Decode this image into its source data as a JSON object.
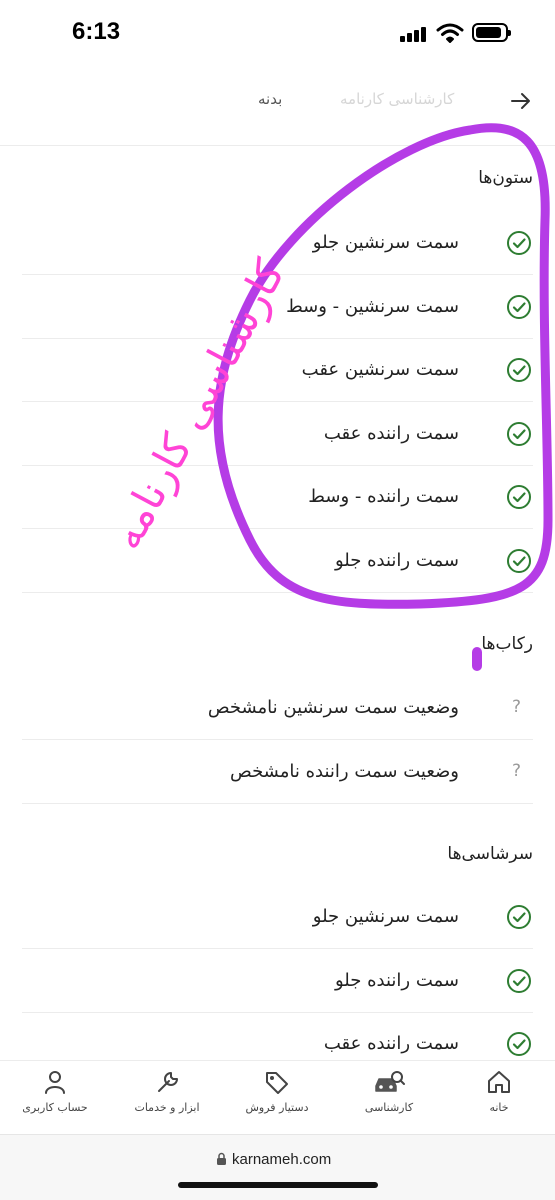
{
  "status_bar": {
    "time": "6:13",
    "battery_level": 0.9
  },
  "header": {
    "title": "کارشناسی کارنامه",
    "crumb": "بدنه"
  },
  "sections": {
    "pillars": {
      "title": "ستون‌ها",
      "items": [
        {
          "label": "سمت سرنشین جلو",
          "status": "ok"
        },
        {
          "label": "سمت سرنشین - وسط",
          "status": "ok"
        },
        {
          "label": "سمت سرنشین عقب",
          "status": "ok"
        },
        {
          "label": "سمت راننده عقب",
          "status": "ok"
        },
        {
          "label": "سمت راننده - وسط",
          "status": "ok"
        },
        {
          "label": "سمت راننده جلو",
          "status": "ok"
        }
      ]
    },
    "steps": {
      "title": "رکاب‌ها",
      "items": [
        {
          "label": "وضعیت سمت سرنشین نامشخص",
          "status": "unknown",
          "icon": "?"
        },
        {
          "label": "وضعیت سمت راننده نامشخص",
          "status": "unknown",
          "icon": "?"
        }
      ]
    },
    "roof_rails": {
      "title": "سرشاسی‌ها",
      "items": [
        {
          "label": "سمت سرنشین جلو",
          "status": "ok"
        },
        {
          "label": "سمت راننده جلو",
          "status": "ok"
        },
        {
          "label": "سمت راننده عقب",
          "status": "ok"
        }
      ]
    }
  },
  "annotation": {
    "text": "کارشناسی کارنامه",
    "color": "#ff44d6",
    "marker_color": "#b53ce6"
  },
  "tabbar": {
    "items": [
      {
        "label": "خانه",
        "icon": "home-icon"
      },
      {
        "label": "کارشناسی",
        "icon": "car-inspection-icon"
      },
      {
        "label": "دستیار فروش",
        "icon": "tag-icon"
      },
      {
        "label": "ابزار و خدمات",
        "icon": "wrench-icon"
      },
      {
        "label": "حساب کاربری",
        "icon": "user-icon"
      }
    ]
  },
  "browser": {
    "url": "karnameh.com"
  },
  "colors": {
    "check_green": "#2e7d32",
    "divider": "#ececec"
  }
}
